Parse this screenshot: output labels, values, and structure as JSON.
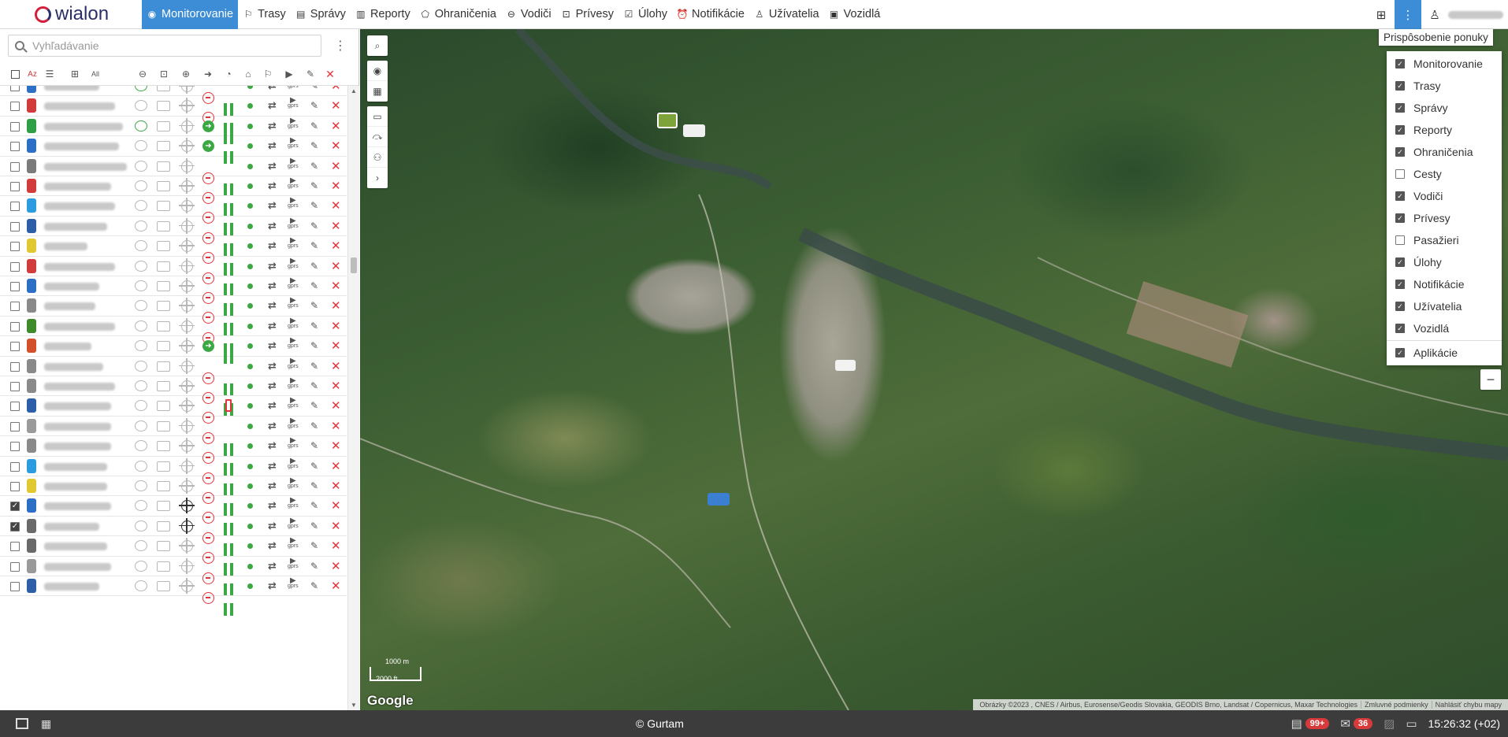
{
  "app": {
    "logo_text": "wialon"
  },
  "nav": {
    "items": [
      {
        "label": "Monitorovanie",
        "icon": "globe-icon",
        "glyph": "◉",
        "active": true
      },
      {
        "label": "Trasy",
        "icon": "route-flag-icon",
        "glyph": "⚐",
        "active": false
      },
      {
        "label": "Správy",
        "icon": "messages-icon",
        "glyph": "▤",
        "active": false
      },
      {
        "label": "Reporty",
        "icon": "report-chart-icon",
        "glyph": "▥",
        "active": false
      },
      {
        "label": "Ohraničenia",
        "icon": "geofence-icon",
        "glyph": "⬠",
        "active": false
      },
      {
        "label": "Vodiči",
        "icon": "steering-wheel-icon",
        "glyph": "⊖",
        "active": false
      },
      {
        "label": "Prívesy",
        "icon": "trailer-icon",
        "glyph": "⊡",
        "active": false
      },
      {
        "label": "Úlohy",
        "icon": "task-checklist-icon",
        "glyph": "☑",
        "active": false
      },
      {
        "label": "Notifikácie",
        "icon": "alarm-clock-icon",
        "glyph": "⏰",
        "active": false
      },
      {
        "label": "Užívatelia",
        "icon": "user-icon",
        "glyph": "♙",
        "active": false
      },
      {
        "label": "Vozidlá",
        "icon": "bus-icon",
        "glyph": "▣",
        "active": false
      }
    ],
    "right_tooltip": "Prispôsobenie ponuky"
  },
  "search": {
    "placeholder": "Vyhľadávanie"
  },
  "customize_menu": {
    "items": [
      {
        "label": "Monitorovanie",
        "checked": true
      },
      {
        "label": "Trasy",
        "checked": true
      },
      {
        "label": "Správy",
        "checked": true
      },
      {
        "label": "Reporty",
        "checked": true
      },
      {
        "label": "Ohraničenia",
        "checked": true
      },
      {
        "label": "Cesty",
        "checked": false
      },
      {
        "label": "Vodiči",
        "checked": true
      },
      {
        "label": "Prívesy",
        "checked": true
      },
      {
        "label": "Pasažieri",
        "checked": false
      },
      {
        "label": "Úlohy",
        "checked": true
      },
      {
        "label": "Notifikácie",
        "checked": true
      },
      {
        "label": "Užívatelia",
        "checked": true
      },
      {
        "label": "Vozidlá",
        "checked": true
      },
      {
        "label": "Aplikácie",
        "checked": true
      }
    ]
  },
  "units": [
    {
      "car_color": "#2d6fc7",
      "checked": false,
      "drive": "green",
      "action": "stop",
      "batt": false
    },
    {
      "car_color": "#d23b3b",
      "checked": false,
      "drive": "grey",
      "action": "stop",
      "batt": false
    },
    {
      "car_color": "#2f9e44",
      "checked": false,
      "drive": "green",
      "action": "go",
      "batt": false
    },
    {
      "car_color": "#2d6fc7",
      "checked": false,
      "drive": "grey",
      "action": "go",
      "batt": false
    },
    {
      "car_color": "#7b7b7b",
      "checked": false,
      "drive": "grey",
      "action": "stop",
      "batt": false
    },
    {
      "car_color": "#d23b3b",
      "checked": false,
      "drive": "grey",
      "action": "stop",
      "batt": false
    },
    {
      "car_color": "#2d9be0",
      "checked": false,
      "drive": "grey",
      "action": "stop",
      "batt": false
    },
    {
      "car_color": "#2d5fa8",
      "checked": false,
      "drive": "grey",
      "action": "stop",
      "batt": false
    },
    {
      "car_color": "#e0c830",
      "checked": false,
      "drive": "grey",
      "action": "stop",
      "batt": false
    },
    {
      "car_color": "#d23b3b",
      "checked": false,
      "drive": "grey",
      "action": "stop",
      "batt": false
    },
    {
      "car_color": "#2d6fc7",
      "checked": false,
      "drive": "grey",
      "action": "stop",
      "batt": false
    },
    {
      "car_color": "#8a8a8a",
      "checked": false,
      "drive": "grey",
      "action": "stop",
      "batt": false
    },
    {
      "car_color": "#3f8a2a",
      "checked": false,
      "drive": "grey",
      "action": "stop",
      "batt": false
    },
    {
      "car_color": "#d2502c",
      "checked": false,
      "drive": "grey",
      "action": "go",
      "batt": false
    },
    {
      "car_color": "#8a8a8a",
      "checked": false,
      "drive": "grey",
      "action": "stop",
      "batt": false
    },
    {
      "car_color": "#8a8a8a",
      "checked": false,
      "drive": "grey",
      "action": "stop",
      "batt": false
    },
    {
      "car_color": "#2d5fa8",
      "checked": false,
      "drive": "grey",
      "action": "stop",
      "batt": true
    },
    {
      "car_color": "#9a9a9a",
      "checked": false,
      "drive": "grey",
      "action": "stop",
      "batt": false
    },
    {
      "car_color": "#8a8a8a",
      "checked": false,
      "drive": "grey",
      "action": "stop",
      "batt": false
    },
    {
      "car_color": "#2d9be0",
      "checked": false,
      "drive": "grey",
      "action": "stop",
      "batt": false
    },
    {
      "car_color": "#e0c830",
      "checked": false,
      "drive": "grey",
      "action": "stop",
      "batt": false
    },
    {
      "car_color": "#2d6fc7",
      "checked": true,
      "drive": "grey",
      "action": "stop",
      "batt": false
    },
    {
      "car_color": "#6a6a6a",
      "checked": true,
      "drive": "grey",
      "action": "stop",
      "batt": false
    },
    {
      "car_color": "#6a6a6a",
      "checked": false,
      "drive": "grey",
      "action": "stop",
      "batt": false
    },
    {
      "car_color": "#9a9a9a",
      "checked": false,
      "drive": "grey",
      "action": "stop",
      "batt": false
    },
    {
      "car_color": "#2d5fa8",
      "checked": false,
      "drive": "grey",
      "action": "stop",
      "batt": false
    }
  ],
  "map": {
    "scale_top": "1000 m",
    "scale_bottom": "2000 ft",
    "google_logo": "Google",
    "attribution": "Obrázky ©2023 , CNES / Airbus, Eurosense/Geodis Slovakia, GEODIS Brno, Landsat / Copernicus, Maxar Technologies",
    "terms": "Zmluvné podmienky",
    "report": "Nahlásiť chybu mapy"
  },
  "bottom": {
    "copyright": "© Gurtam",
    "messages_badge": "99+",
    "mail_badge": "36",
    "time": "15:26:32 (+02)"
  },
  "colors": {
    "accent": "#3d8dd6",
    "alert": "#e2343a",
    "ok": "#3ca844"
  }
}
